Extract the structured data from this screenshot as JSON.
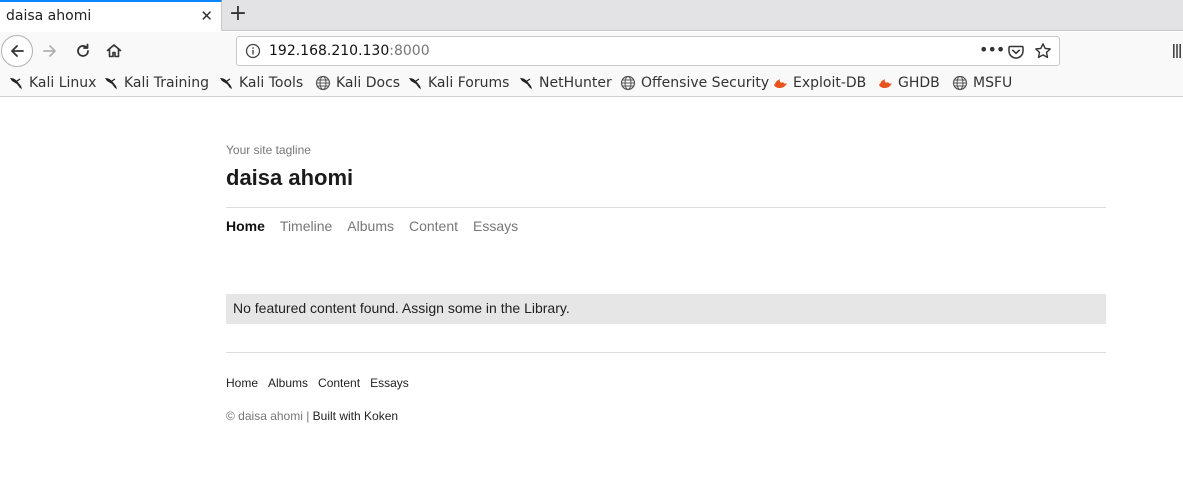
{
  "browser": {
    "tab": {
      "title": "daisa ahomi",
      "close_glyph": "✕"
    },
    "new_tab_glyph": "+",
    "url": {
      "host": "192.168.210.130",
      "port": ":8000"
    },
    "page_actions_glyph": "•••",
    "bookmarks": [
      {
        "label": "Kali Linux",
        "icon": "kali-dragon"
      },
      {
        "label": "Kali Training",
        "icon": "kali-dragon"
      },
      {
        "label": "Kali Tools",
        "icon": "kali-dragon"
      },
      {
        "label": "Kali Docs",
        "icon": "globe"
      },
      {
        "label": "Kali Forums",
        "icon": "kali-dragon"
      },
      {
        "label": "NetHunter",
        "icon": "kali-dragon"
      },
      {
        "label": "Offensive Security",
        "icon": "globe"
      },
      {
        "label": "Exploit-DB",
        "icon": "exploitdb-flame"
      },
      {
        "label": "GHDB",
        "icon": "exploitdb-flame"
      },
      {
        "label": "MSFU",
        "icon": "globe"
      }
    ],
    "colors": {
      "accent": "#0a84ff",
      "flame": "#e8531d"
    }
  },
  "site": {
    "tagline": "Your site tagline",
    "title": "daisa ahomi",
    "nav": [
      "Home",
      "Timeline",
      "Albums",
      "Content",
      "Essays"
    ],
    "active_nav": "Home",
    "notice": "No featured content found. Assign some in the Library.",
    "footer_nav": [
      "Home",
      "Albums",
      "Content",
      "Essays"
    ],
    "copyright": "© daisa ahomi | ",
    "built_with": "Built with Koken"
  }
}
